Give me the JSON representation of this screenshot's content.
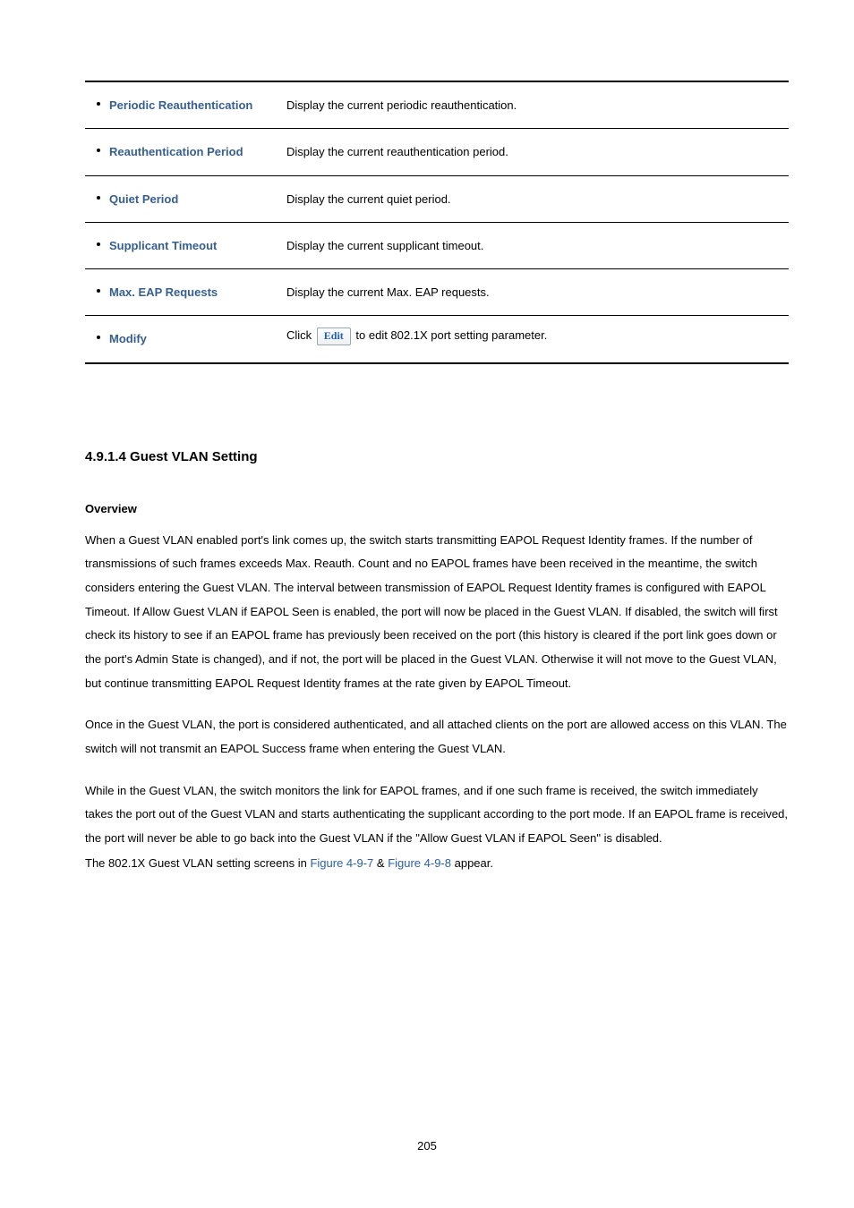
{
  "table": {
    "rows": [
      {
        "label": "Periodic Reauthentication",
        "desc": "Display the current periodic reauthentication."
      },
      {
        "label": "Reauthentication Period",
        "desc": "Display the current reauthentication period."
      },
      {
        "label": "Quiet Period",
        "desc": "Display the current quiet period."
      },
      {
        "label": "Supplicant Timeout",
        "desc": "Display the current supplicant timeout."
      },
      {
        "label": "Max. EAP Requests",
        "desc": "Display the current Max. EAP requests."
      }
    ],
    "modify": {
      "label": "Modify",
      "prefix": "Click ",
      "button": "Edit",
      "suffix": " to edit 802.1X port setting parameter."
    }
  },
  "section_heading": "4.9.1.4 Guest VLAN Setting",
  "overview_label": "Overview",
  "paragraphs": {
    "p1": "When a Guest VLAN enabled port's link comes up, the switch starts transmitting EAPOL Request Identity frames. If the number of transmissions of such frames exceeds Max. Reauth. Count and no EAPOL frames have been received in the meantime, the switch considers entering the Guest VLAN. The interval between transmission of EAPOL Request Identity frames is configured with EAPOL Timeout. If Allow Guest VLAN if EAPOL Seen is enabled, the port will now be placed in the Guest VLAN. If disabled, the switch will first check its history to see if an EAPOL frame has previously been received on the port (this history is cleared if the port link goes down or the port's Admin State is changed), and if not, the port will be placed in the Guest VLAN. Otherwise it will not move to the Guest VLAN, but continue transmitting EAPOL Request Identity frames at the rate given by EAPOL Timeout.",
    "p2": "Once in the Guest VLAN, the port is considered authenticated, and all attached clients on the port are allowed access on this VLAN. The switch will not transmit an EAPOL Success frame when entering the Guest VLAN.",
    "p3": "While in the Guest VLAN, the switch monitors the link for EAPOL frames, and if one such frame is received, the switch immediately takes the port out of the Guest VLAN and starts authenticating the supplicant according to the port mode. If an EAPOL frame is received, the port will never be able to go back into the Guest VLAN if the \"Allow Guest VLAN if EAPOL Seen\" is disabled.",
    "p4_prefix": "The 802.1X Guest VLAN setting screens in ",
    "fig1": "Figure 4-9-7",
    "amp": " & ",
    "fig2": "Figure 4-9-8",
    "p4_suffix": " appear."
  },
  "page_number": "205"
}
